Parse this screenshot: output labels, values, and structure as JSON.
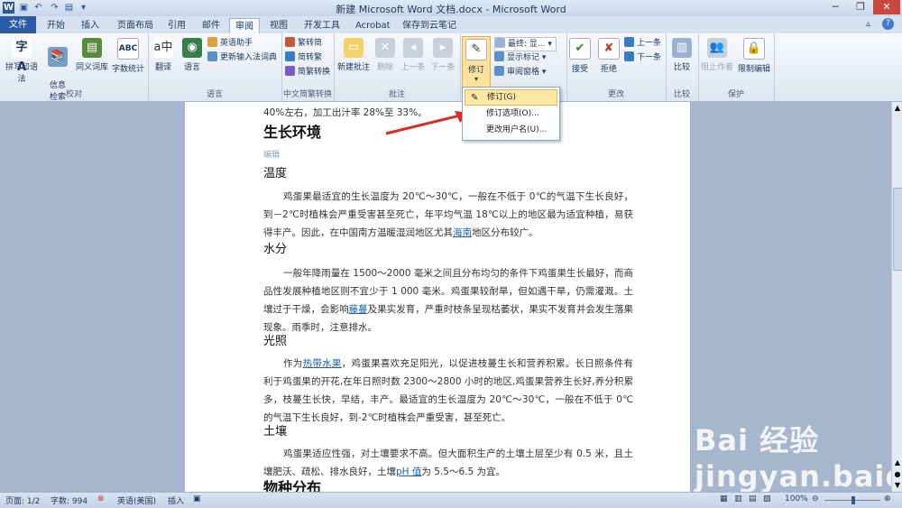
{
  "window": {
    "title": "新建 Microsoft Word 文档.docx - Microsoft Word",
    "app_icon": "W"
  },
  "tabs": [
    "文件",
    "开始",
    "插入",
    "页面布局",
    "引用",
    "邮件",
    "审阅",
    "视图",
    "开发工具",
    "Acrobat",
    "保存到云笔记"
  ],
  "active_tab": "审阅",
  "ribbon": {
    "proofing": {
      "label": "校对",
      "spell": "拼写和语法",
      "info": "信息\n检索",
      "thesaurus": "同义词库",
      "wordcount": "字数统计"
    },
    "language": {
      "label": "语言",
      "translate": "翻译",
      "language": "语言",
      "eng_assist": "英语助手",
      "update_ime": "更新输入法词典"
    },
    "chinese": {
      "label": "中文简繁转换",
      "t2s": "繁转简",
      "s2t": "简转繁",
      "convert": "简繁转换"
    },
    "comments": {
      "label": "批注",
      "new": "新建批注",
      "delete": "删除",
      "prev": "上一条",
      "next": "下一条"
    },
    "tracking": {
      "label": "",
      "track": "修订",
      "final": "最终: 显...",
      "show_markup": "显示标记",
      "review_pane": "审阅窗格"
    },
    "changes": {
      "label": "更改",
      "accept": "接受",
      "reject": "拒绝",
      "prev": "上一条",
      "next": "下一条"
    },
    "compare": {
      "label": "比较",
      "compare": "比较"
    },
    "protect": {
      "label": "保护",
      "block": "阻止作者",
      "restrict": "限制编辑"
    }
  },
  "dropdown": {
    "items": [
      "修订(G)",
      "修订选项(O)...",
      "更改用户名(U)..."
    ],
    "selected": 0
  },
  "document": {
    "top_line": "40%左右，加工出汁率 28%至 33%。",
    "heading": "生长环境",
    "edit": "编辑",
    "sections": [
      {
        "title": "温度",
        "text": "鸡蛋果最适宜的生长温度为 20℃～30℃，一般在不低于 0℃的气温下生长良好，到－2℃时植株会严重受害甚至死亡，年平均气温 18℃以上的地区最为适宜种植，易获得丰产。因此，在中国南方温暖湿润地区尤其",
        "link": "海南",
        "after": "地区分布较广。"
      },
      {
        "title": "水分",
        "text": "一般年降雨量在 1500～2000 毫米之间且分布均匀的条件下鸡蛋果生长最好，而商品性发展种植地区则不宜少于 1 000 毫米。鸡蛋果较耐旱，但如遇干旱，仍需灌溉。土壤过于干燥，会影响",
        "link": "藤蔓",
        "after": "及果实发育，严重时枝条呈现枯萎状，果实不发育并会发生落果现象。雨季时，注意排水。"
      },
      {
        "title": "光照",
        "pre": "作为",
        "link": "热带水果",
        "text": "，鸡蛋果喜欢充足阳光，以促进枝蔓生长和营养积累。长日照条件有利于鸡蛋果的开花,在年日照时数 2300～2800 小时的地区,鸡蛋果营养生长好,养分积累多，枝蔓生长快，早结，丰产。最适宜的生长温度为 20℃～30℃，一般在不低于 0℃的气温下生长良好，到-2℃时植株会严重受害，甚至死亡。"
      },
      {
        "title": "土壤",
        "text": "鸡蛋果适应性强，对土壤要求不高。但大面积生产的土壤土层至少有 0.5 米，且土壤肥沃、疏松、排水良好，土壤",
        "link": "pH 值",
        "after": "为 5.5～6.5 为宜。"
      }
    ],
    "next_heading": "物种分布"
  },
  "status": {
    "page": "页面: 1/2",
    "words": "字数: 994",
    "lang": "英语(美国)",
    "mode": "插入",
    "zoom": "100%"
  },
  "watermark": "Bai 经验 jingyan.baidu.com"
}
